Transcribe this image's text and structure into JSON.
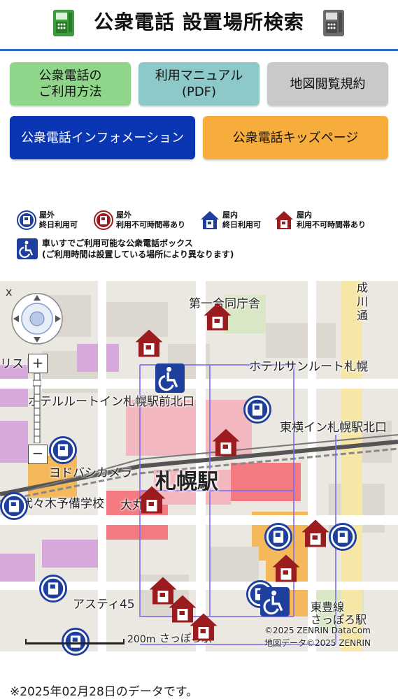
{
  "header": {
    "title": "公衆電話 設置場所検索",
    "colors": {
      "rule": "#2a6fc0",
      "phone_green": "#3d9a3d",
      "phone_gray": "#6b6b6b"
    }
  },
  "buttons": {
    "how_to_use": "公衆電話の\nご利用方法",
    "manual": "利用マニュアル\n(PDF)",
    "terms": "地図閲覧規約",
    "info": "公衆電話インフォメーション",
    "kids": "公衆電話キッズページ"
  },
  "legend": {
    "outdoor_all_day": "屋外\n終日利用可",
    "outdoor_limited": "屋外\n利用不可時間帯あり",
    "indoor_all_day": "屋内\n終日利用可",
    "indoor_limited": "屋内\n利用不可時間帯あり",
    "wheelchair": "車いすでご利用可能な公衆電話ボックス\n(ご利用時間は設置している場所により異なります)",
    "colors": {
      "blue": "#1f3f9e",
      "red": "#9b1c1f",
      "wheelchair": "#1f3f9e"
    }
  },
  "map": {
    "labels": {
      "daiichi": "第一合同庁舎",
      "hotel_sunroute": "ホテルサンルート札幌",
      "hotel_route_inn": "ホテルルートイン札幌駅前北口",
      "toyoko": "東横イン札幌駅北口",
      "yodobashi": "ヨドバシカメラ",
      "yobi": "代々木予備学校",
      "sapporo_station": "札幌駅",
      "daimaru": "大丸",
      "asty": "アスティ45",
      "toho_line": "東豊線\nさっぽろ駅",
      "sapporo_small": "さっぽろ駅",
      "route_partial": "リスト",
      "seiseki": "成\n川\n通"
    },
    "scale": "200m",
    "copyright": "©2025 ZENRIN DataCom\n地図データ©2025 ZENRIN",
    "close": "x"
  },
  "footer": {
    "note": "※2025年02月28日のデータです。"
  }
}
